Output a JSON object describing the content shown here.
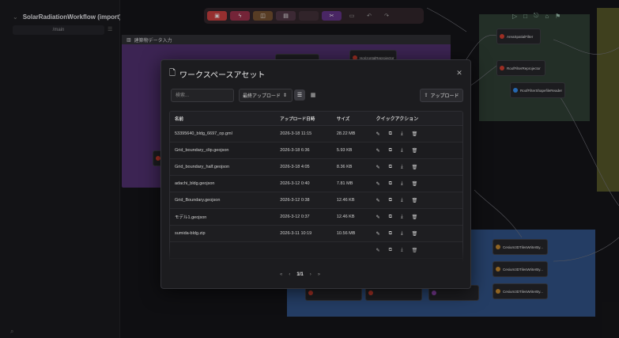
{
  "app": {
    "workflow_title": "SolarRadiationWorkflow (import)",
    "user_initial": "S",
    "branch": "/main"
  },
  "toolbar": {
    "buttons": [
      {
        "icon": "save-icon",
        "color": "#b83a3a"
      },
      {
        "icon": "bolt-icon",
        "color": "#8e2d45"
      },
      {
        "icon": "layers-icon",
        "color": "#6b4a2c"
      },
      {
        "icon": "doc-icon",
        "color": "#4a3340"
      },
      {
        "icon": "blank",
        "color": "#3c2c34"
      },
      {
        "icon": "scissors-icon",
        "color": "#5a2f7a"
      }
    ]
  },
  "canvas": {
    "group_label": "建築物データ入力",
    "nodes": [
      {
        "label": "AreaSpatialFilter"
      },
      {
        "label": "RoofFilterReprojector"
      },
      {
        "label": "RoofFilterShapefileReader"
      },
      {
        "label": "HorizontalReprojector"
      },
      {
        "label": "Cesium3DTilesWriterBy..."
      },
      {
        "label": "Cesium3DTilesWriterBy..."
      },
      {
        "label": "Cesium3DTilesWriterBy..."
      }
    ]
  },
  "modal": {
    "title": "ワークスペースアセット",
    "search_placeholder": "検索...",
    "sort_label": "最終アップロード",
    "upload_label": "アップロード",
    "columns": {
      "name": "名前",
      "date": "アップロード日時",
      "size": "サイズ",
      "actions": "クイックアクション"
    },
    "rows": [
      {
        "name": "53395640_bldg_6697_op.gml",
        "date": "2026-3-18 11:15",
        "size": "28.22 MB"
      },
      {
        "name": "Grid_boundary_clip.geojson",
        "date": "2026-3-18 6:36",
        "size": "5.93 KB"
      },
      {
        "name": "Grid_boundary_half.geojson",
        "date": "2026-3-18 4:05",
        "size": "8.36 KB"
      },
      {
        "name": "adachi_bldg.geojson",
        "date": "2026-3-12 0:40",
        "size": "7.81 MB"
      },
      {
        "name": "Grid_Boundary.geojson",
        "date": "2026-3-12 0:38",
        "size": "12.46 KB"
      },
      {
        "name": "モデル1.geojson",
        "date": "2026-3-12 0:37",
        "size": "12.46 KB"
      },
      {
        "name": "sumida-bldg.zip",
        "date": "2026-3-11 10:19",
        "size": "10.56 MB"
      },
      {
        "name": "",
        "date": "",
        "size": ""
      }
    ],
    "pagination": {
      "current": "1/1"
    }
  }
}
